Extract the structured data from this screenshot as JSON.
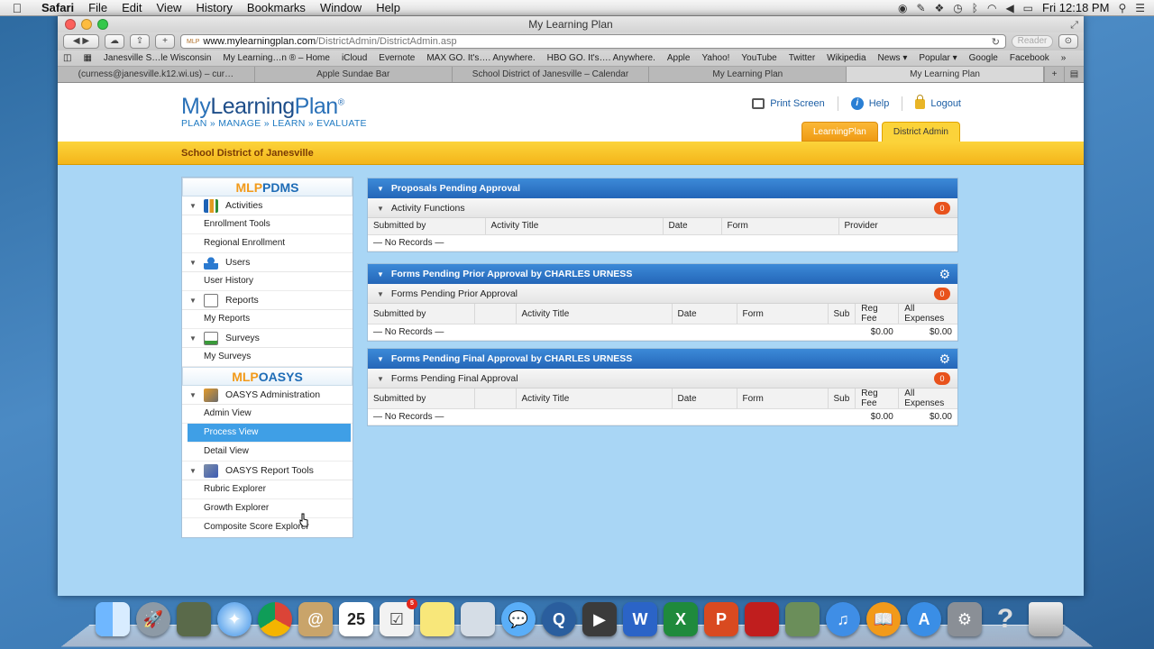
{
  "menubar": {
    "app": "Safari",
    "items": [
      "File",
      "Edit",
      "View",
      "History",
      "Bookmarks",
      "Window",
      "Help"
    ],
    "clock": "Fri 12:18 PM"
  },
  "window": {
    "title": "My Learning Plan",
    "url_host": "www.mylearningplan.com",
    "url_path": "/DistrictAdmin/DistrictAdmin.asp",
    "url_icon_text": "MLP",
    "reader": "Reader"
  },
  "bookmarks": [
    "Janesville S…le Wisconsin",
    "My Learning…n ® – Home",
    "iCloud",
    "Evernote",
    "MAX GO. It's…. Anywhere.",
    "HBO GO. It's…. Anywhere.",
    "Apple",
    "Yahoo!",
    "YouTube",
    "Twitter",
    "Wikipedia",
    "News ▾",
    "Popular ▾",
    "Google",
    "Facebook"
  ],
  "tabs": [
    "(curness@janesville.k12.wi.us) – cur…",
    "Apple Sundae Bar",
    "School District of Janesville – Calendar",
    "My Learning Plan",
    "My Learning Plan"
  ],
  "header": {
    "logo_my": "My",
    "logo_learning": "Learning",
    "logo_plan": "Plan",
    "logo_reg": "®",
    "tagline": "PLAN » MANAGE » LEARN » EVALUATE",
    "print": "Print Screen",
    "help": "Help",
    "logout": "Logout",
    "help_glyph": "i",
    "tab_lp": "LearningPlan",
    "tab_da": "District Admin"
  },
  "district": "School District of Janesville",
  "sidebar": {
    "pdms_a": "MLP",
    "pdms_b": "PDMS",
    "oasys_a": "MLP",
    "oasys_b": "OASYS",
    "activities": "Activities",
    "enrollment_tools": "Enrollment Tools",
    "regional_enrollment": "Regional Enrollment",
    "users": "Users",
    "user_history": "User History",
    "reports": "Reports",
    "my_reports": "My Reports",
    "surveys": "Surveys",
    "my_surveys": "My Surveys",
    "oasys_admin": "OASYS Administration",
    "admin_view": "Admin View",
    "process_view": "Process View",
    "detail_view": "Detail View",
    "report_tools": "OASYS Report Tools",
    "rubric": "Rubric Explorer",
    "growth": "Growth Explorer",
    "composite": "Composite Score Explorer"
  },
  "panel1": {
    "title": "Proposals Pending Approval",
    "sub": "Activity Functions",
    "count": "0",
    "cols": [
      "Submitted by",
      "Activity Title",
      "Date",
      "Form",
      "Provider"
    ],
    "empty": "— No Records —"
  },
  "panel2": {
    "title": "Forms Pending Prior Approval by CHARLES URNESS",
    "sub": "Forms Pending Prior Approval",
    "count": "0",
    "cols": [
      "Submitted by",
      "",
      "Activity Title",
      "Date",
      "Form",
      "Sub",
      "Reg Fee",
      "All Expenses"
    ],
    "empty": "— No Records —",
    "reg_fee": "$0.00",
    "all_expenses": "$0.00"
  },
  "panel3": {
    "title": "Forms Pending Final Approval by CHARLES URNESS",
    "sub": "Forms Pending Final Approval",
    "count": "0",
    "cols": [
      "Submitted by",
      "",
      "Activity Title",
      "Date",
      "Form",
      "Sub",
      "Reg Fee",
      "All Expenses"
    ],
    "empty": "— No Records —",
    "reg_fee": "$0.00",
    "all_expenses": "$0.00"
  },
  "dock": {
    "calendar_day": "25",
    "reminders_badge": "5"
  },
  "colors": {
    "accent_blue": "#2466b8",
    "district_bar": "#f4b51a",
    "badge": "#e8521c",
    "selected_item": "#3f9fe6"
  }
}
